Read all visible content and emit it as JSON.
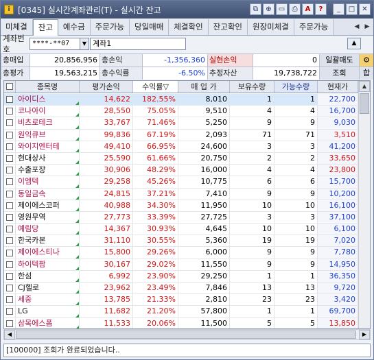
{
  "window": {
    "icon_text": "i",
    "title": "[0345] 실시간계좌관리(T) - 실시간 잔고"
  },
  "tabs": [
    {
      "label": "미체결"
    },
    {
      "label": "잔고"
    },
    {
      "label": "예수금"
    },
    {
      "label": "주문가능"
    },
    {
      "label": "당일매매"
    },
    {
      "label": "체결확인"
    },
    {
      "label": "잔고확인"
    },
    {
      "label": "원장미체결"
    },
    {
      "label": "주문가능"
    }
  ],
  "account": {
    "label": "계좌번호",
    "number": "****-**07",
    "name": "계좌1"
  },
  "summary": {
    "total_buy_label": "총매입",
    "total_buy": "20,856,956",
    "total_pl_label": "총손익",
    "total_pl": "-1,356,360",
    "realized_label": "실현손익",
    "realized": "0",
    "bulk_sell_label": "일괄매도",
    "total_eval_label": "총평가",
    "total_eval": "19,563,215",
    "total_return_label": "총수익률",
    "total_return": "-6.50%",
    "est_assets_label": "추정자산",
    "est_assets": "19,738,722",
    "query_button": "조회",
    "sum_button": "합"
  },
  "grid": {
    "headers": {
      "name": "종목명",
      "eval_pl": "평가손익",
      "return": "수익률▽",
      "buy_price": "매 입 가",
      "qty": "보유수량",
      "avail": "가능수량",
      "cur": "현재가"
    },
    "rows": [
      {
        "name": "아이디스",
        "pl": "14,622",
        "ret": "182.55%",
        "buy": "8,010",
        "qty": "1",
        "avail": "1",
        "cur": "22,700",
        "dir": "up",
        "pink": true
      },
      {
        "name": "코나아이",
        "pl": "28,550",
        "ret": "75.05%",
        "buy": "9,510",
        "qty": "4",
        "avail": "4",
        "cur": "16,700",
        "dir": "up",
        "pink": true
      },
      {
        "name": "비츠로테크",
        "pl": "33,767",
        "ret": "71.46%",
        "buy": "5,250",
        "qty": "9",
        "avail": "9",
        "cur": "9,030",
        "dir": "up",
        "pink": true
      },
      {
        "name": "원익큐브",
        "pl": "99,836",
        "ret": "67.19%",
        "buy": "2,093",
        "qty": "71",
        "avail": "71",
        "cur": "3,510",
        "dir": "dn",
        "pink": true
      },
      {
        "name": "와이지엔터테",
        "pl": "49,410",
        "ret": "66.95%",
        "buy": "24,600",
        "qty": "3",
        "avail": "3",
        "cur": "41,200",
        "dir": "up",
        "pink": true
      },
      {
        "name": "현대상사",
        "pl": "25,590",
        "ret": "61.66%",
        "buy": "20,750",
        "qty": "2",
        "avail": "2",
        "cur": "33,650",
        "dir": "dn",
        "pink": false
      },
      {
        "name": "수출포장",
        "pl": "30,906",
        "ret": "48.29%",
        "buy": "16,000",
        "qty": "4",
        "avail": "4",
        "cur": "23,800",
        "dir": "dn",
        "pink": false
      },
      {
        "name": "이엠텍",
        "pl": "29,258",
        "ret": "45.26%",
        "buy": "10,775",
        "qty": "6",
        "avail": "6",
        "cur": "15,700",
        "dir": "up",
        "pink": true
      },
      {
        "name": "동일금속",
        "pl": "24,815",
        "ret": "37.21%",
        "buy": "7,410",
        "qty": "9",
        "avail": "9",
        "cur": "10,200",
        "dir": "up",
        "pink": true
      },
      {
        "name": "제이에스코퍼",
        "pl": "40,988",
        "ret": "34.30%",
        "buy": "11,950",
        "qty": "10",
        "avail": "10",
        "cur": "16,100",
        "dir": "up",
        "pink": false
      },
      {
        "name": "영원무역",
        "pl": "27,773",
        "ret": "33.39%",
        "buy": "27,725",
        "qty": "3",
        "avail": "3",
        "cur": "37,100",
        "dir": "up",
        "pink": false
      },
      {
        "name": "예림당",
        "pl": "14,367",
        "ret": "30.93%",
        "buy": "4,645",
        "qty": "10",
        "avail": "10",
        "cur": "6,100",
        "dir": "up",
        "pink": true
      },
      {
        "name": "한국카본",
        "pl": "31,110",
        "ret": "30.55%",
        "buy": "5,360",
        "qty": "19",
        "avail": "19",
        "cur": "7,020",
        "dir": "up",
        "pink": false
      },
      {
        "name": "제이에스티나",
        "pl": "15,800",
        "ret": "29.26%",
        "buy": "6,000",
        "qty": "9",
        "avail": "9",
        "cur": "7,780",
        "dir": "up",
        "pink": true
      },
      {
        "name": "하이텍팜",
        "pl": "30,167",
        "ret": "29.02%",
        "buy": "11,550",
        "qty": "9",
        "avail": "9",
        "cur": "14,950",
        "dir": "up",
        "pink": true
      },
      {
        "name": "한섬",
        "pl": "6,992",
        "ret": "23.90%",
        "buy": "29,250",
        "qty": "1",
        "avail": "1",
        "cur": "36,350",
        "dir": "up",
        "pink": false
      },
      {
        "name": "CJ헬로",
        "pl": "23,962",
        "ret": "23.49%",
        "buy": "7,846",
        "qty": "13",
        "avail": "13",
        "cur": "9,720",
        "dir": "up",
        "pink": false
      },
      {
        "name": "세중",
        "pl": "13,785",
        "ret": "21.33%",
        "buy": "2,810",
        "qty": "23",
        "avail": "23",
        "cur": "3,420",
        "dir": "up",
        "pink": true
      },
      {
        "name": "LG",
        "pl": "11,682",
        "ret": "21.20%",
        "buy": "57,800",
        "qty": "1",
        "avail": "1",
        "cur": "69,700",
        "dir": "up",
        "pink": false
      },
      {
        "name": "삼목에스폼",
        "pl": "11,533",
        "ret": "20.06%",
        "buy": "11,500",
        "qty": "5",
        "avail": "5",
        "cur": "13,850",
        "dir": "dn",
        "pink": true
      }
    ]
  },
  "status": {
    "text": "[100000] 조회가 완료되었습니다.."
  },
  "colors": {
    "up": "#d31212",
    "down": "#1c3fd0",
    "pink_name": "#b0104a"
  }
}
